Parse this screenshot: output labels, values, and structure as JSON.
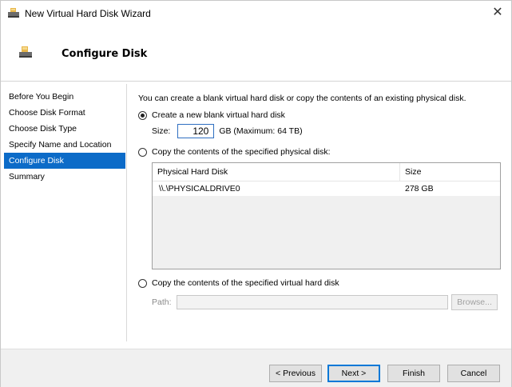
{
  "window": {
    "title": "New Virtual Hard Disk Wizard",
    "close_glyph": "✕",
    "icon": "virtual-disk-icon"
  },
  "header": {
    "title": "Configure Disk",
    "icon": "virtual-disk-icon"
  },
  "nav": {
    "items": [
      {
        "label": "Before You Begin",
        "active": false
      },
      {
        "label": "Choose Disk Format",
        "active": false
      },
      {
        "label": "Choose Disk Type",
        "active": false
      },
      {
        "label": "Specify Name and Location",
        "active": false
      },
      {
        "label": "Configure Disk",
        "active": true
      },
      {
        "label": "Summary",
        "active": false
      }
    ]
  },
  "main": {
    "intro": "You can create a blank virtual hard disk or copy the contents of an existing physical disk.",
    "option_new": {
      "label": "Create a new blank virtual hard disk",
      "selected": true,
      "size_label": "Size:",
      "size_value": "120",
      "size_unit": "GB (Maximum: 64 TB)"
    },
    "option_physical": {
      "label": "Copy the contents of the specified physical disk:",
      "selected": false,
      "table": {
        "columns": [
          "Physical Hard Disk",
          "Size"
        ],
        "rows": [
          {
            "name": "\\\\.\\PHYSICALDRIVE0",
            "size": "278 GB"
          }
        ]
      }
    },
    "option_virtual": {
      "label": "Copy the contents of the specified virtual hard disk",
      "selected": false,
      "path_label": "Path:",
      "path_value": "",
      "browse_label": "Browse..."
    }
  },
  "footer": {
    "previous": "< Previous",
    "next": "Next >",
    "finish": "Finish",
    "cancel": "Cancel"
  },
  "colors": {
    "accent": "#0c6bc8",
    "default_button_border": "#0078d7"
  }
}
